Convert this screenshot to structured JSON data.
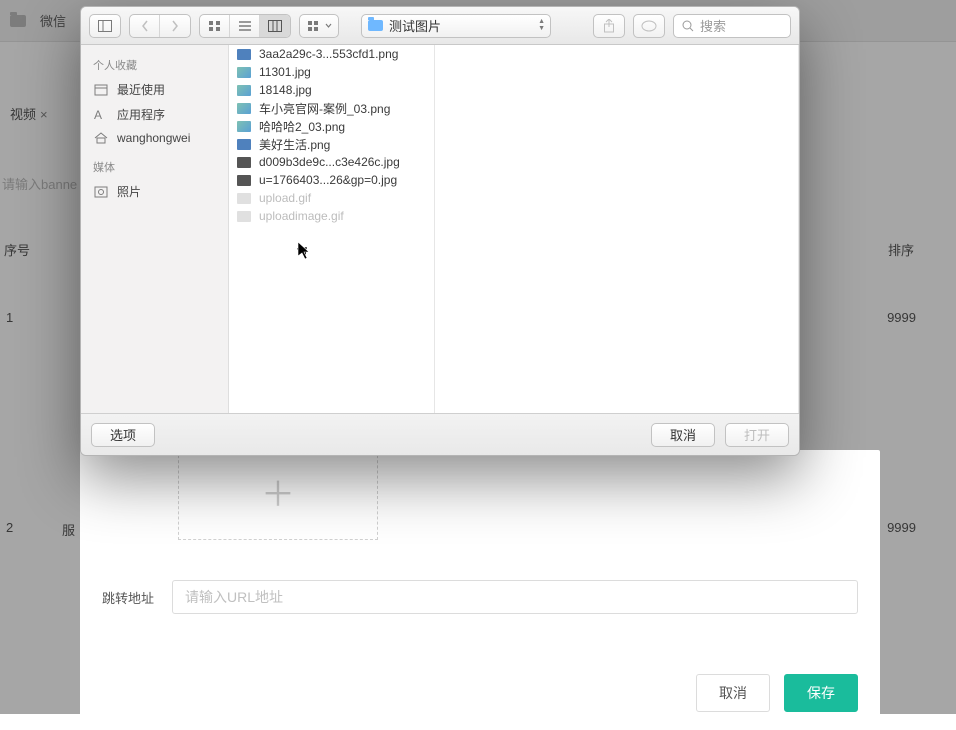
{
  "bg": {
    "topbar_item": "微信",
    "tab_label": "视频",
    "banner_placeholder": "请输入banne",
    "th_seq": "序号",
    "th_sort": "排序",
    "row1_num": "1",
    "row1_sort": "9999",
    "row2_num": "2",
    "row2_svc": "服",
    "row2_sort": "9999"
  },
  "frontPanel": {
    "jump_label": "跳转地址",
    "jump_placeholder": "请输入URL地址",
    "cancel": "取消",
    "save": "保存"
  },
  "macDialog": {
    "path_label": "测试图片",
    "search_placeholder": "搜索",
    "sidebar": {
      "fav_header": "个人收藏",
      "recent": "最近使用",
      "apps": "应用程序",
      "home": "wanghongwei",
      "media_header": "媒体",
      "photos": "照片"
    },
    "files": [
      {
        "name": "3aa2a29c-3...553cfd1.png",
        "thumb": "blue",
        "dim": false
      },
      {
        "name": "11301.jpg",
        "thumb": "img",
        "dim": false
      },
      {
        "name": "18148.jpg",
        "thumb": "img",
        "dim": false
      },
      {
        "name": "车小亮官网-案例_03.png",
        "thumb": "img",
        "dim": false
      },
      {
        "name": "哈哈哈2_03.png",
        "thumb": "img",
        "dim": false
      },
      {
        "name": "美好生活.png",
        "thumb": "blue",
        "dim": false
      },
      {
        "name": "d009b3de9c...c3e426c.jpg",
        "thumb": "dk",
        "dim": false
      },
      {
        "name": "u=1766403...26&gp=0.jpg",
        "thumb": "dk",
        "dim": false
      },
      {
        "name": "upload.gif",
        "thumb": "dim-th",
        "dim": true
      },
      {
        "name": "uploadimage.gif",
        "thumb": "dim-th",
        "dim": true
      }
    ],
    "footer": {
      "options": "选项",
      "cancel": "取消",
      "open": "打开"
    }
  }
}
